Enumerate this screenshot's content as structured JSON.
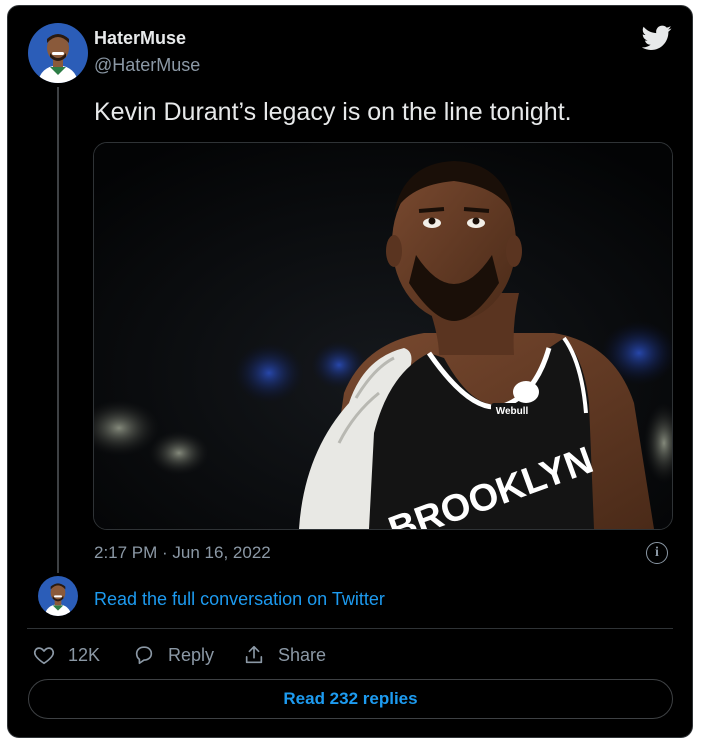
{
  "tweet": {
    "author": {
      "display_name": "HaterMuse",
      "handle": "@HaterMuse",
      "avatar_icon": "cartoon-player-avatar-icon"
    },
    "text": "Kevin Durant’s legacy is on the line tonight.",
    "media": {
      "type": "photo",
      "jersey_text": "BROOKLYN",
      "sponsor_text": "Webull"
    },
    "timestamp": "2:17 PM · Jun 16, 2022",
    "info_icon": "info-icon",
    "brand_icon": "twitter-bird-icon"
  },
  "conversation": {
    "link_text": "Read the full conversation on Twitter"
  },
  "actions": {
    "like": {
      "icon": "heart-icon",
      "count": "12K"
    },
    "reply": {
      "icon": "reply-bubble-icon",
      "label": "Reply"
    },
    "share": {
      "icon": "share-icon",
      "label": "Share"
    }
  },
  "replies_button": {
    "label": "Read 232 replies"
  },
  "colors": {
    "background": "#000000",
    "text_primary": "#e7e9ea",
    "text_secondary": "#8b98a5",
    "accent": "#1d9bf0",
    "border": "#2f3336"
  }
}
